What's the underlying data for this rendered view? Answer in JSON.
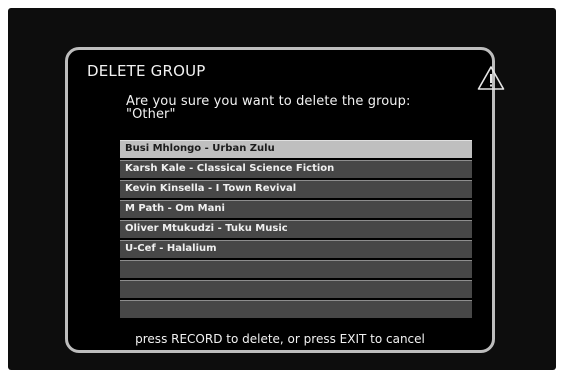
{
  "dialog": {
    "title": "DELETE GROUP",
    "warning_icon": "warning-triangle-icon",
    "prompt_line1": "Are you sure you want to delete the group:",
    "prompt_line2": "\"Other\""
  },
  "list": {
    "selected_index": 0,
    "items": [
      "Busi Mhlongo - Urban Zulu",
      "Karsh Kale - Classical Science Fiction",
      "Kevin Kinsella - I Town Revival",
      "M Path - Om Mani",
      "Oliver Mtukudzi - Tuku Music",
      "U-Cef - Halalium",
      "",
      "",
      ""
    ]
  },
  "footer": {
    "instruction": "press RECORD to delete, or press EXIT to cancel"
  },
  "colors": {
    "dialog_background": "#000000",
    "dialog_border": "#bdbdbd",
    "row_background": "#474747",
    "row_selected_background": "#bfbfbf",
    "text": "#f2f2f2"
  }
}
